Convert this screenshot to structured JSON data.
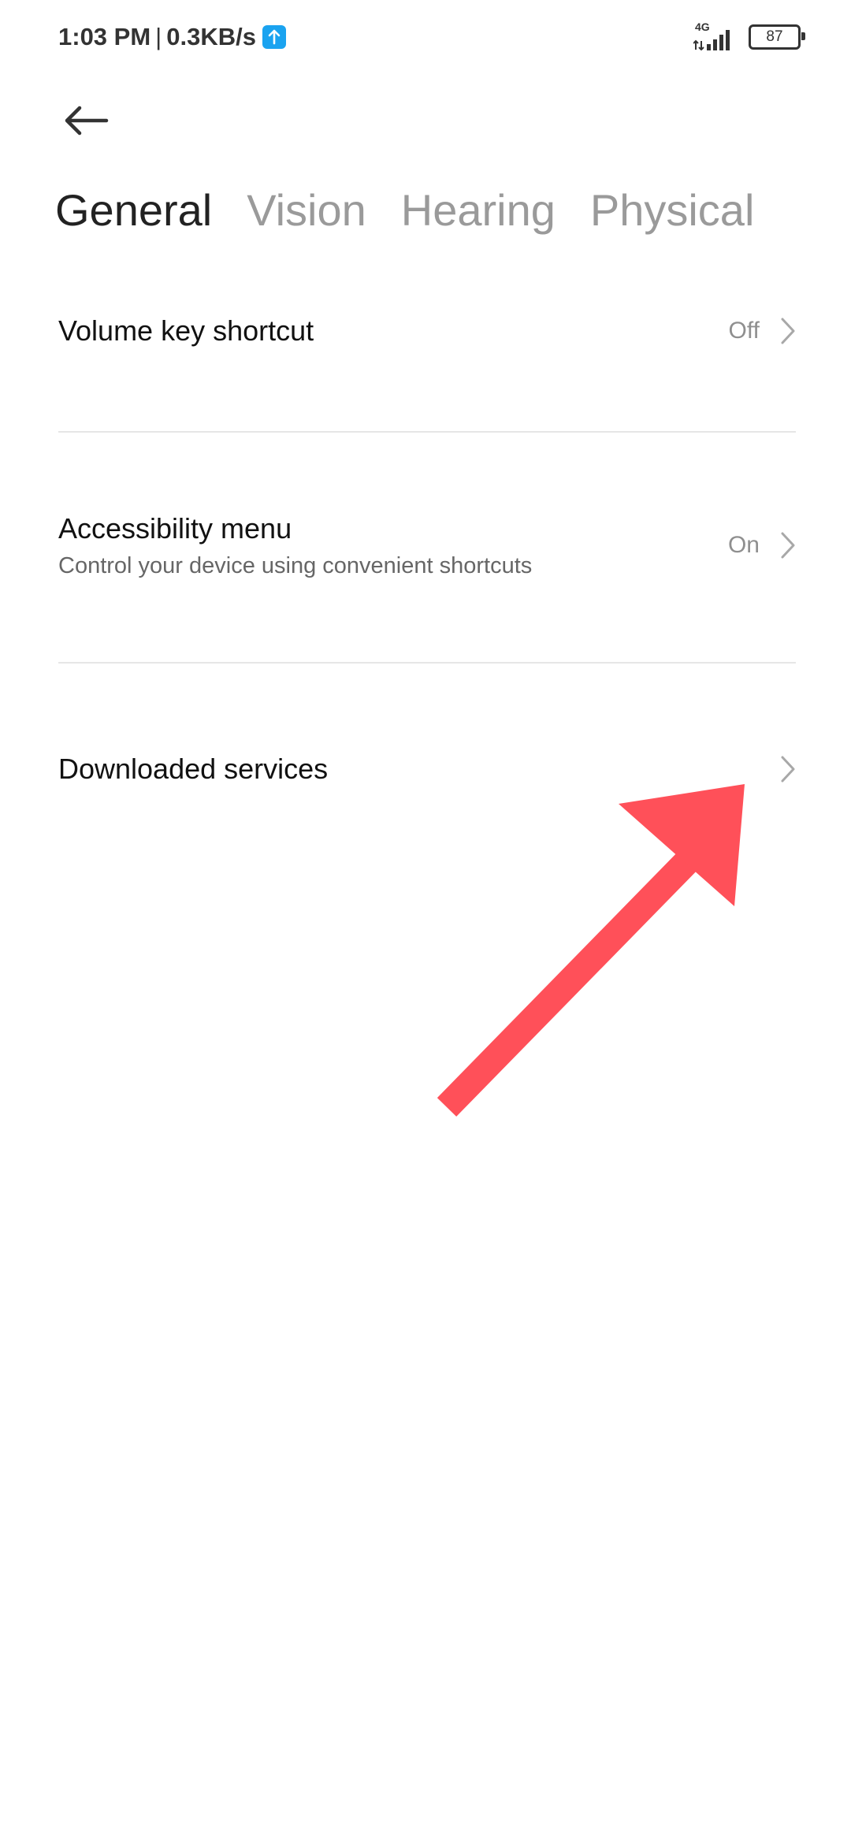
{
  "status_bar": {
    "time": "1:03 PM",
    "separator": "|",
    "speed": "0.3KB/s",
    "network": "4G",
    "battery": "87",
    "upload_icon": "upload-arrow-icon",
    "signal_icon": "signal-bars-icon"
  },
  "nav": {
    "back_icon": "back-arrow-icon"
  },
  "tabs": [
    {
      "label": "General",
      "active": true
    },
    {
      "label": "Vision",
      "active": false
    },
    {
      "label": "Hearing",
      "active": false
    },
    {
      "label": "Physical",
      "active": false
    }
  ],
  "items": [
    {
      "title": "Volume key shortcut",
      "subtitle": "",
      "value": "Off"
    },
    {
      "title": "Accessibility menu",
      "subtitle": "Control your device using convenient shortcuts",
      "value": "On"
    },
    {
      "title": "Downloaded services",
      "subtitle": "",
      "value": ""
    }
  ],
  "colors": {
    "annotation_arrow": "#ff5059",
    "upload_badge": "#1aa3f0",
    "active_tab": "#222222",
    "inactive_tab": "#9a9a9a"
  }
}
